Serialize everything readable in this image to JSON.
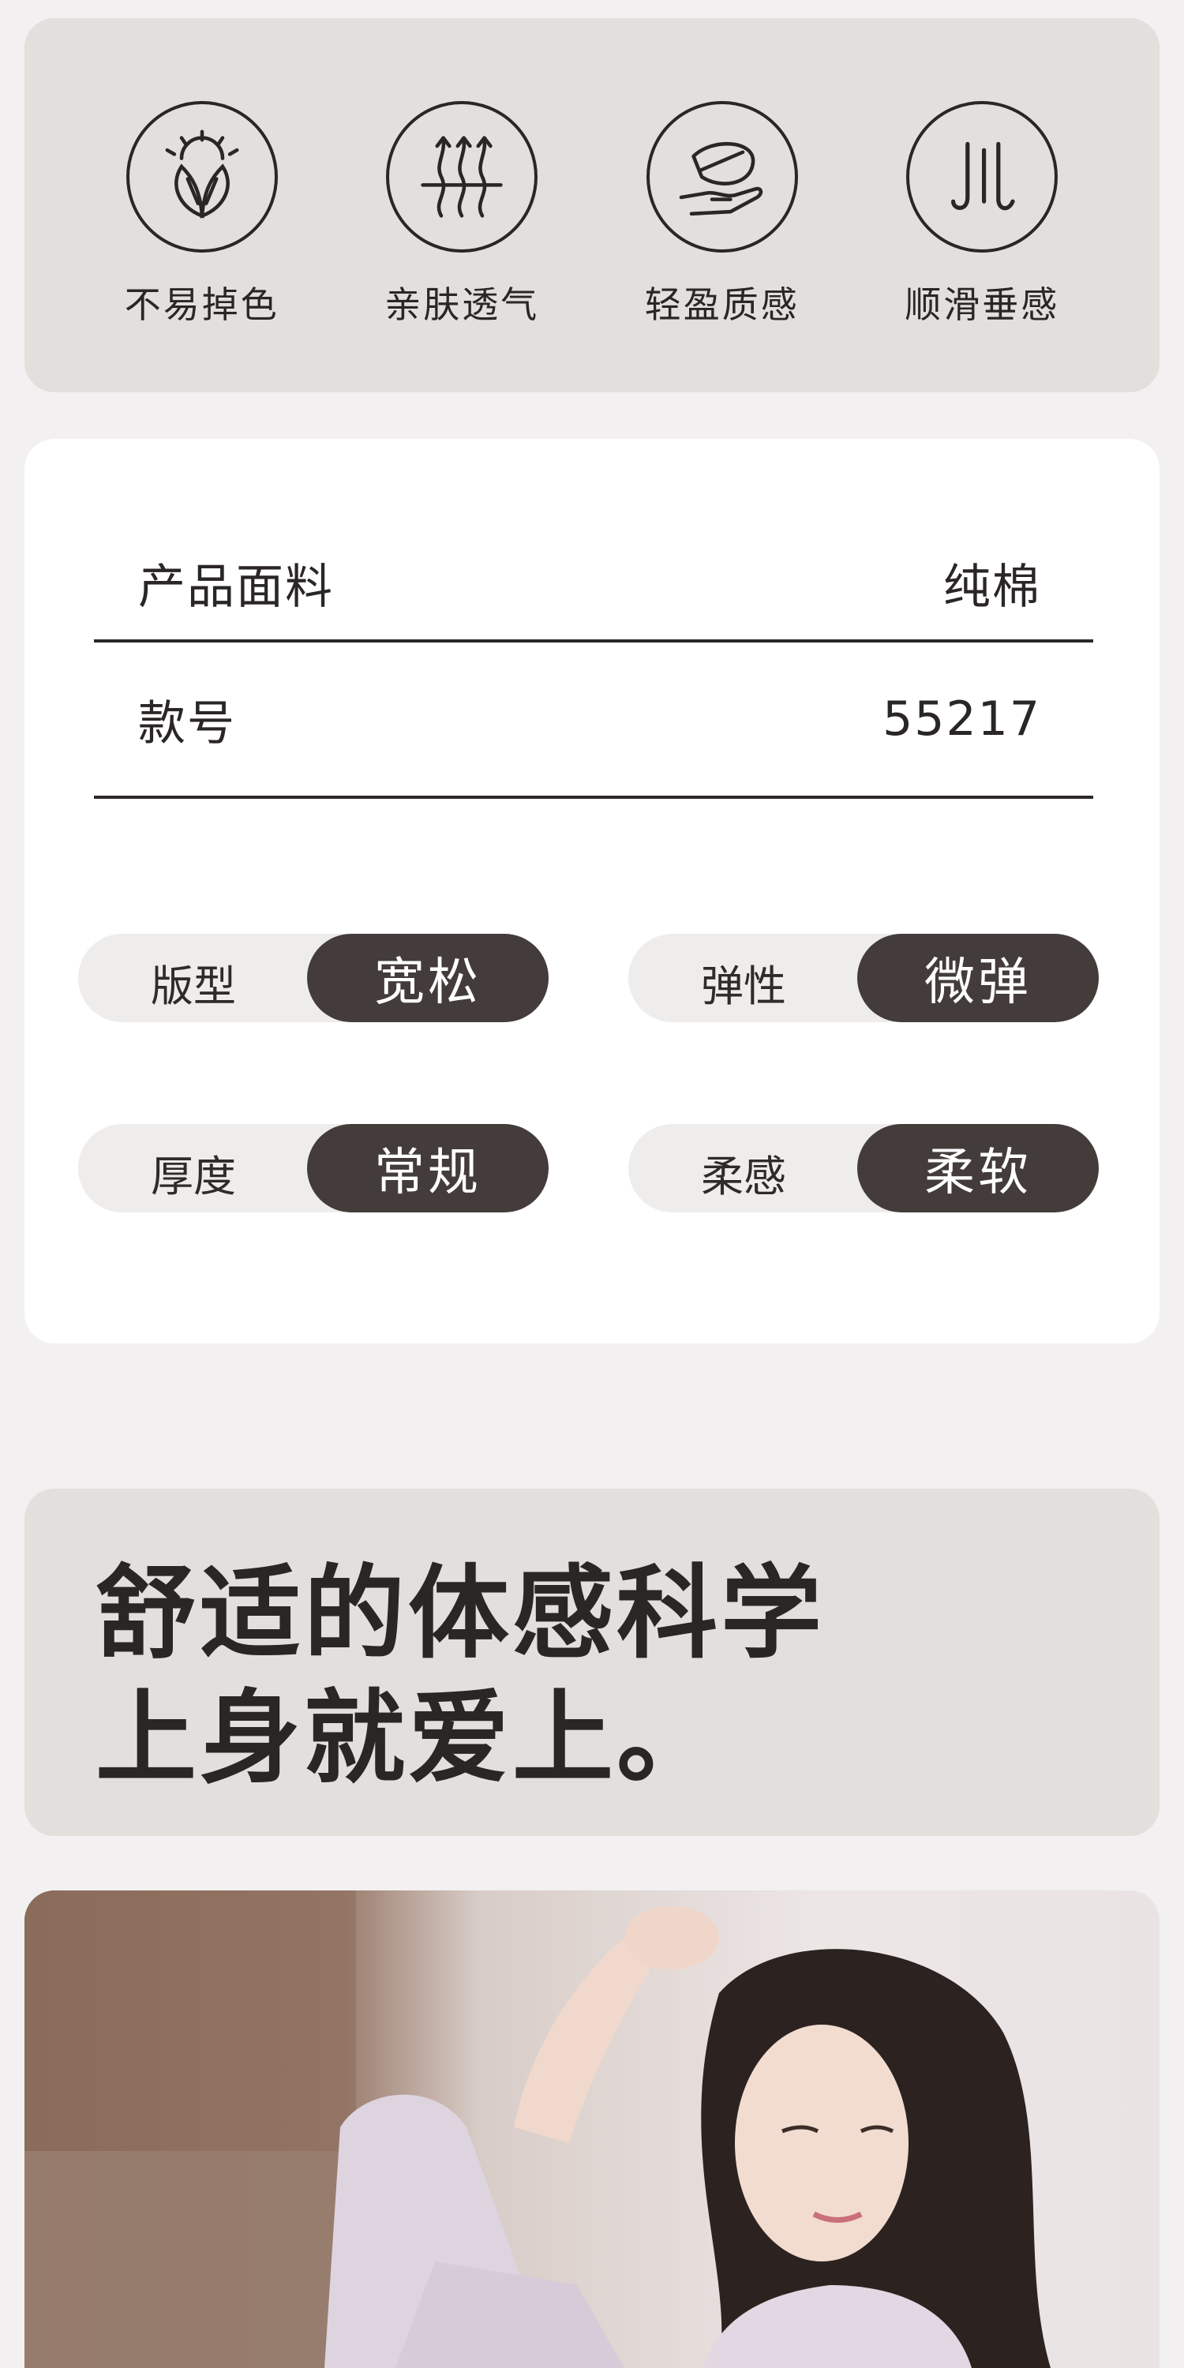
{
  "features": [
    {
      "icon": "leaf-sun-icon",
      "label": "不易掉色"
    },
    {
      "icon": "breathable-arrows-icon",
      "label": "亲肤透气"
    },
    {
      "icon": "feather-hand-icon",
      "label": "轻盈质感"
    },
    {
      "icon": "drape-lines-icon",
      "label": "顺滑垂感"
    }
  ],
  "specs": {
    "rows": [
      {
        "label": "产品面料",
        "value": "纯棉"
      },
      {
        "label": "款号",
        "value": "55217"
      }
    ],
    "attributes": [
      {
        "label": "版型",
        "value": "宽松"
      },
      {
        "label": "弹性",
        "value": "微弹"
      },
      {
        "label": "厚度",
        "value": "常规"
      },
      {
        "label": "柔感",
        "value": "柔软"
      }
    ]
  },
  "headline": {
    "line1": "舒适的体感科学",
    "line2": "上身就爱上。"
  },
  "colors": {
    "card_beige": "#e3dfdc",
    "pill_dark": "#433c3b",
    "page_bg": "#f2f0f0"
  }
}
